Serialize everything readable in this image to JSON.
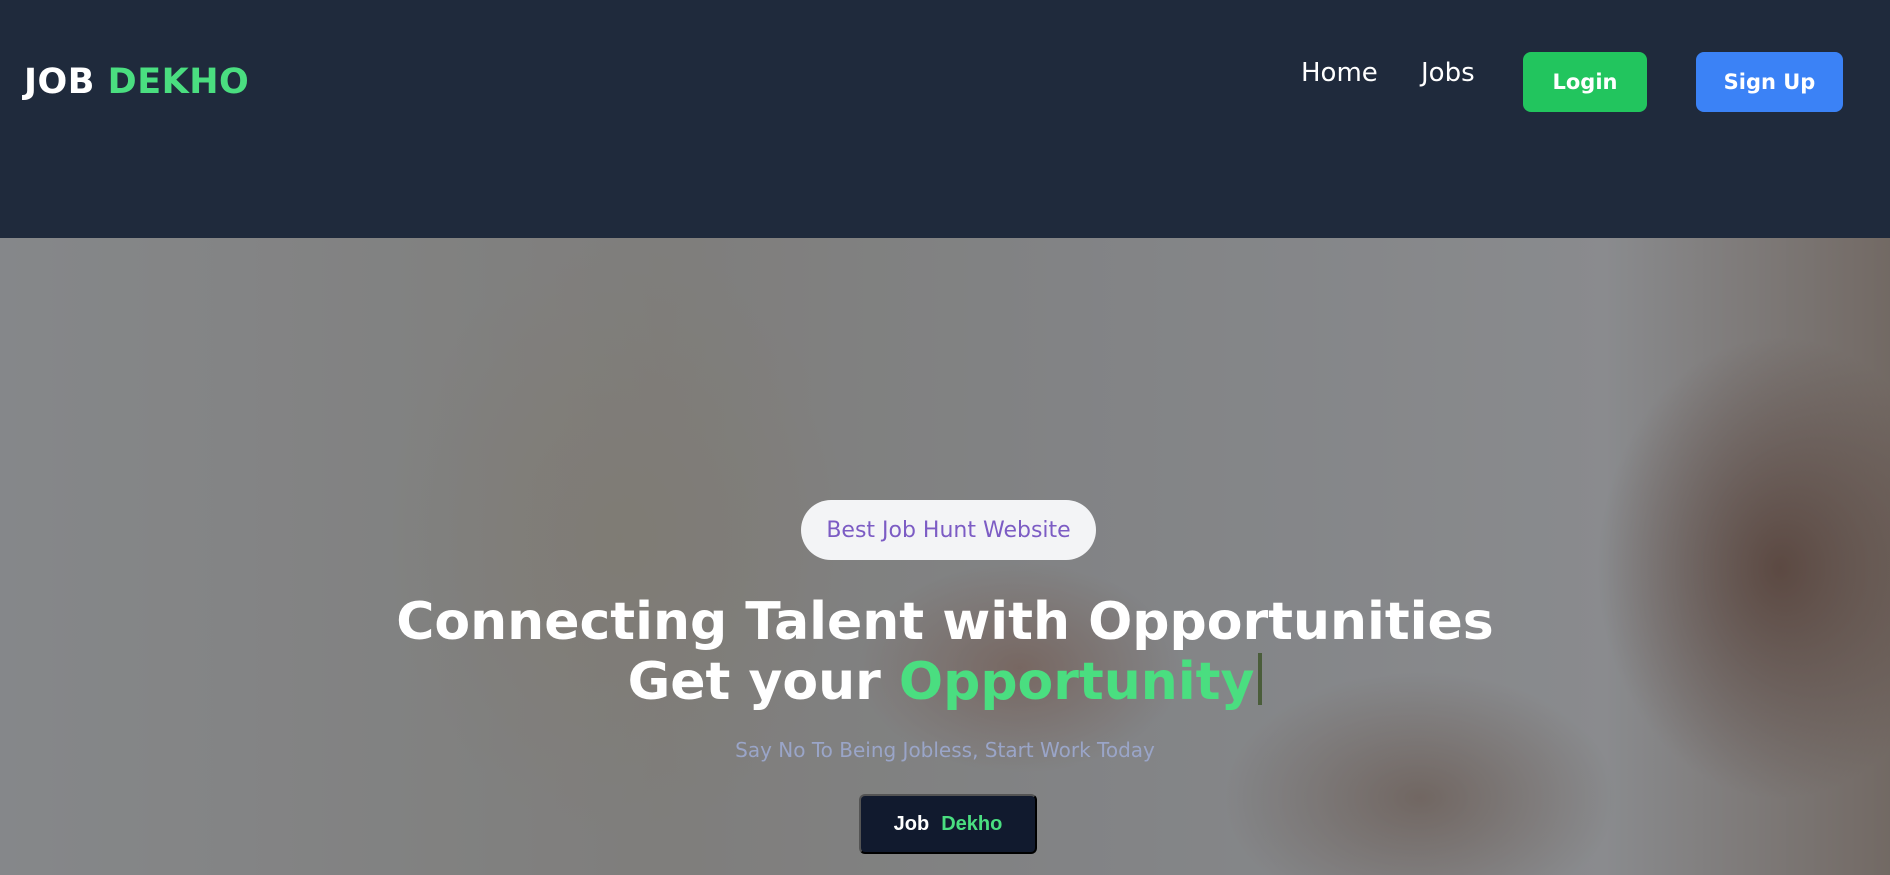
{
  "brand": {
    "part1": "JOB",
    "part2": "DEKHO"
  },
  "nav": {
    "home": "Home",
    "jobs": "Jobs"
  },
  "buttons": {
    "login": "Login",
    "signup": "Sign Up"
  },
  "hero": {
    "badge": "Best Job Hunt Website",
    "headline_line1": "Connecting Talent with Opportunities",
    "headline_line2_prefix": "Get your",
    "headline_line2_highlight": "Opportunity",
    "subtitle": "Say No To Being Jobless, Start Work Today",
    "cta_part1": "Job",
    "cta_part2": "Dekho"
  },
  "colors": {
    "navbar_bg": "#1f2a3c",
    "accent_green": "#4ade80",
    "login_green": "#22c55e",
    "signup_blue": "#3b82f6",
    "badge_text": "#7c5cc4",
    "cta_bg": "#111a2e"
  }
}
